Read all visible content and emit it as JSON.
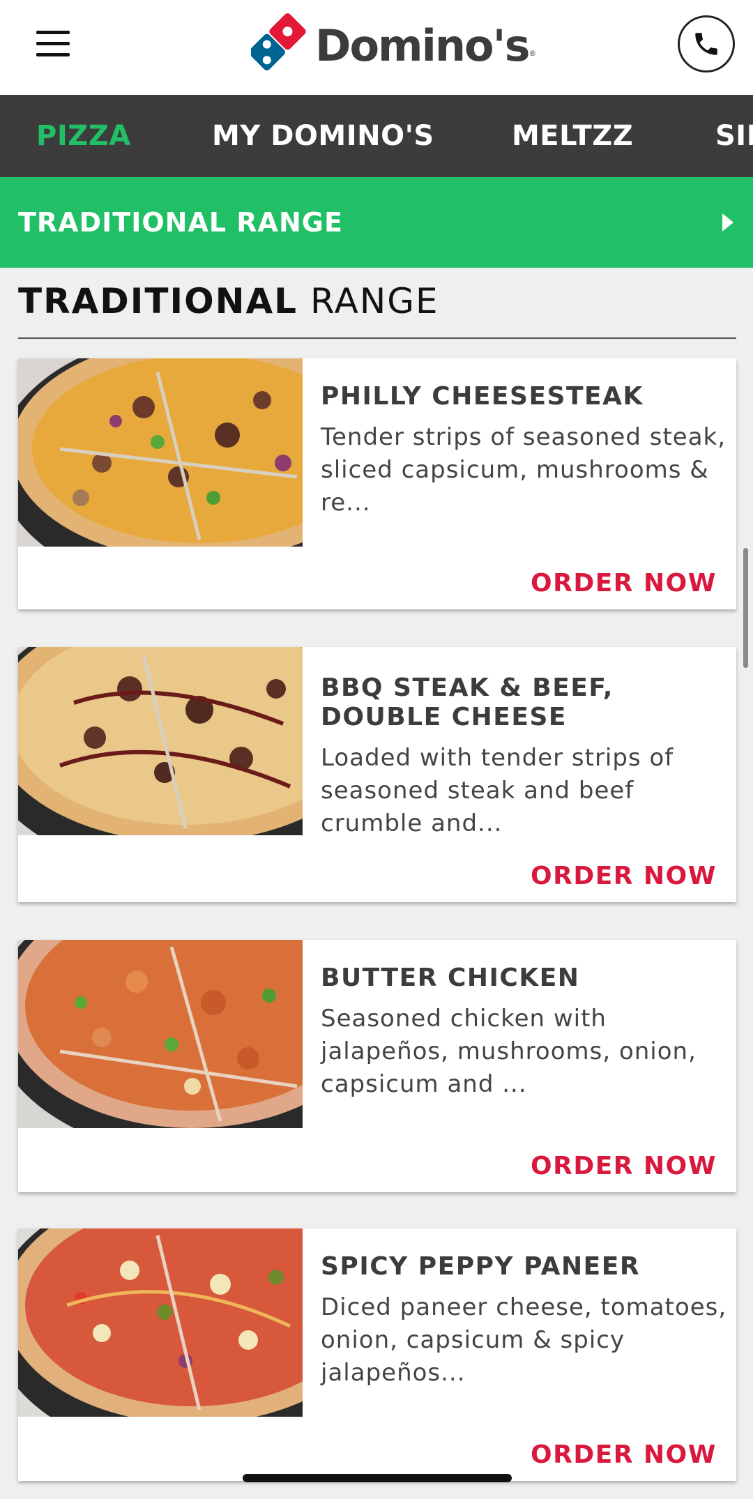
{
  "header": {
    "brand": "Domino's",
    "brand_mark": "®",
    "menu_icon": "hamburger-menu-icon",
    "phone_icon": "phone-icon"
  },
  "nav": {
    "tabs": [
      {
        "label": "PIZZA",
        "active": true
      },
      {
        "label": "MY DOMINO'S",
        "active": false
      },
      {
        "label": "MELTZZ",
        "active": false
      },
      {
        "label": "SIDES",
        "active": false
      }
    ]
  },
  "range_bar": {
    "label": "TRADITIONAL RANGE",
    "icon": "chevron-right-icon"
  },
  "section": {
    "title_bold": "TRADITIONAL",
    "title_light": "RANGE"
  },
  "products": [
    {
      "name": "PHILLY CHEESESTEAK",
      "description": "Tender strips of seasoned steak, sliced capsicum, mushrooms & re...",
      "cta": "ORDER NOW"
    },
    {
      "name": "BBQ STEAK & BEEF, DOUBLE CHEESE",
      "description": "Loaded with tender strips of seasoned steak and beef crumble and...",
      "cta": "ORDER NOW"
    },
    {
      "name": "BUTTER CHICKEN",
      "description": "Seasoned chicken with jalapeños, mushrooms, onion, capsicum and ...",
      "cta": "ORDER NOW"
    },
    {
      "name": "SPICY PEPPY PANEER",
      "description": "Diced paneer cheese, tomatoes, onion, capsicum & spicy jalapeños...",
      "cta": "ORDER NOW"
    }
  ],
  "colors": {
    "accent_green": "#22c066",
    "nav_dark": "#3c3c3c",
    "order_red": "#d9183d",
    "logo_blue": "#006491",
    "logo_red": "#e31837"
  }
}
